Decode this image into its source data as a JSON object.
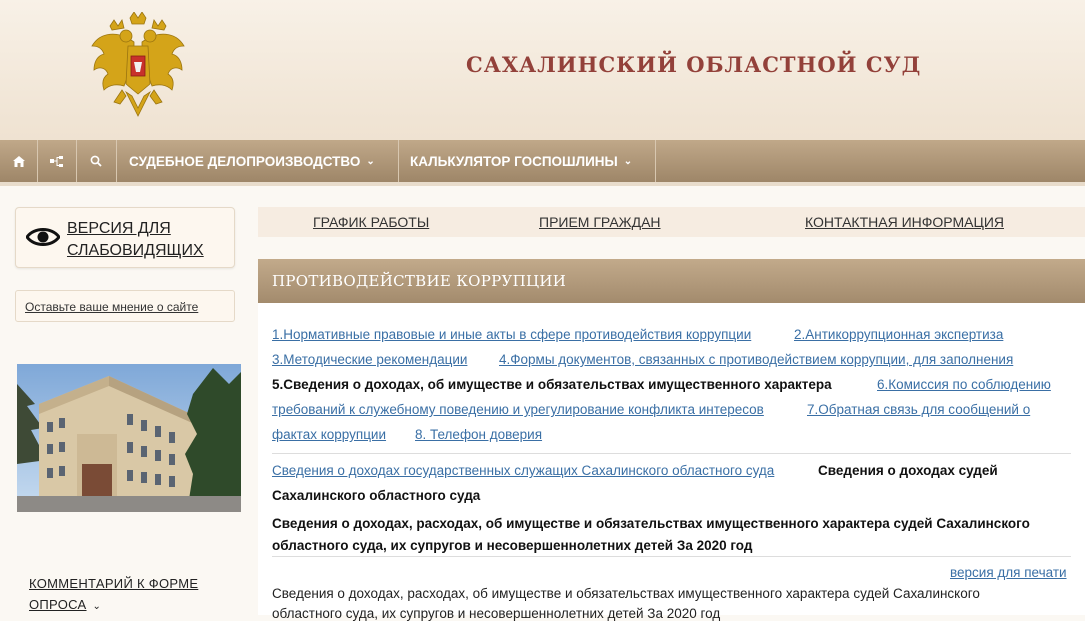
{
  "header": {
    "title": "САХАЛИНСКИЙ ОБЛАСТНОЙ СУД",
    "emblem": "russian-coat-of-arms"
  },
  "nav": {
    "icons": [
      "home-icon",
      "sitemap-icon",
      "search-icon"
    ],
    "items": [
      {
        "label": "СУДЕБНОЕ ДЕЛОПРОИЗВОДСТВО",
        "caret": "⌄"
      },
      {
        "label": "КАЛЬКУЛЯТОР ГОСПОШЛИНЫ",
        "caret": "⌄"
      }
    ]
  },
  "sidebar": {
    "vision": {
      "label_line1": "ВЕРСИЯ ДЛЯ",
      "label_line2": "СЛАБОВИДЯЩИХ"
    },
    "feedback": "Оставьте ваше мнение о сайте",
    "comments": {
      "line1": "КОММЕНТАРИЙ К ФОРМЕ",
      "line2": "ОПРОСА"
    }
  },
  "topmenu": {
    "items": [
      "ГРАФИК РАБОТЫ",
      "ПРИЕМ ГРАЖДАН",
      "КОНТАКТНАЯ ИНФОРМАЦИЯ"
    ]
  },
  "section": {
    "title": "ПРОТИВОДЕЙСТВИЕ КОРРУПЦИИ"
  },
  "content": {
    "links": {
      "l1": "1.Нормативные правовые и иные акты в сфере противодействия коррупции",
      "l2": "2.Антикоррупционная экспертиза",
      "l3": "3.Методические рекомендации",
      "l4": "4.Формы документов, связанных с противодействием коррупции, для заполнения",
      "l5": "5.Сведения о доходах, об имуществе и обязательствах имущественного характера",
      "l6a": "6.Комиссия по соблюдению",
      "l6b": "требований к служебному поведению и урегулирование конфликта интересов",
      "l7a": "7.Обратная связь для сообщений о",
      "l7b": "фактах коррупции",
      "l8": "8. Телефон доверия"
    },
    "sub": {
      "s1": "Сведения о доходах государственных служащих Сахалинского областного суда",
      "s2a": "Сведения о доходах судей",
      "s2b": "Сахалинского областного суда"
    },
    "heading": {
      "line1": "Сведения о доходах, расходах, об имуществе и обязательствах имущественного характера судей Сахалинского",
      "line2": "областного суда, их супругов и несовершеннолетних детей За 2020 год"
    },
    "print_link": "версия для печати",
    "body": {
      "line1": "Сведения о доходах, расходах, об имуществе и обязательствах имущественного характера судей Сахалинского",
      "line2": "областного суда, их супругов и несовершеннолетних детей За 2020 год"
    }
  }
}
